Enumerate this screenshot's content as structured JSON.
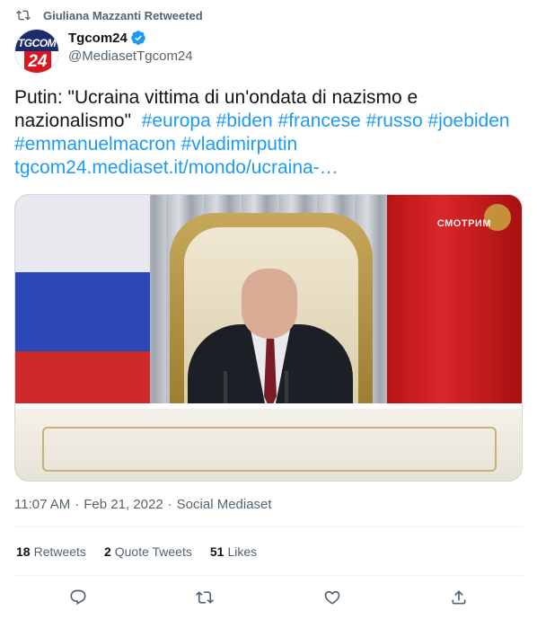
{
  "retweet": {
    "text": "Giuliana Mazzanti Retweeted",
    "icon": "retweet-icon"
  },
  "author": {
    "avatar_text_top": "TGCOM",
    "avatar_text_bottom": "24",
    "display_name": "Tgcom24",
    "verified": true,
    "handle": "@MediasetTgcom24"
  },
  "tweet": {
    "text": "Putin: \"Ucraina vittima di un'ondata di nazismo e nazionalismo\"",
    "hashtags": [
      "#europa",
      "#biden",
      "#francese",
      "#russo",
      "#joebiden",
      "#emmanuelmacron",
      "#vladimirputin"
    ],
    "link": "tgcom24.mediaset.it/mondo/ucraina-…"
  },
  "media": {
    "watermark": "СМОТРИМ"
  },
  "meta": {
    "time": "11:07 AM",
    "separator": "·",
    "date": "Feb 21, 2022",
    "source": "Social Mediaset"
  },
  "stats": {
    "retweets_count": "18",
    "retweets_label": "Retweets",
    "quotes_count": "2",
    "quotes_label": "Quote Tweets",
    "likes_count": "51",
    "likes_label": "Likes"
  },
  "actions": [
    "reply-icon",
    "retweet-icon",
    "like-icon",
    "share-icon"
  ],
  "colors": {
    "accent": "#1d9bf0",
    "secondary_text": "#536471",
    "primary_text": "#0f1419"
  }
}
